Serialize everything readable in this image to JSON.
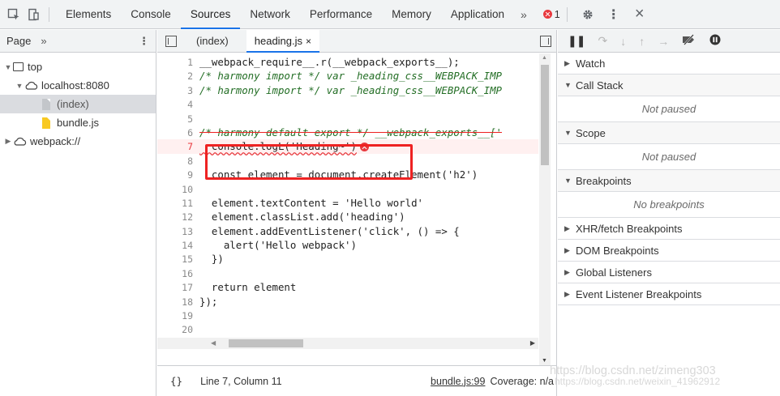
{
  "toolbar": {
    "tabs": [
      "Elements",
      "Console",
      "Sources",
      "Network",
      "Performance",
      "Memory",
      "Application"
    ],
    "active_tab": "Sources",
    "more": "»",
    "error_count": "1",
    "kebab": "⋮",
    "close": "×"
  },
  "navigator": {
    "tab": "Page",
    "chevron": "»",
    "kebab": "⋮",
    "tree": [
      {
        "label": "top"
      },
      {
        "label": "localhost:8080"
      },
      {
        "label": "(index)"
      },
      {
        "label": "bundle.js"
      },
      {
        "label": "webpack://"
      }
    ]
  },
  "editor": {
    "tabs": [
      {
        "label": "(index)"
      },
      {
        "label": "heading.js"
      }
    ],
    "close_glyph": "×",
    "lines": [
      {
        "n": "1",
        "t": "__webpack_require__.r(__webpack_exports__);"
      },
      {
        "n": "2",
        "t": "/* harmony import */ var _heading_css__WEBPACK_IMP"
      },
      {
        "n": "3",
        "t": "/* harmony import */ var _heading_css__WEBPACK_IMP"
      },
      {
        "n": "4",
        "t": ""
      },
      {
        "n": "5",
        "t": ""
      },
      {
        "n": "6",
        "t": "/* harmony default export */ __webpack_exports__['"
      },
      {
        "n": "7",
        "t": "  console.logL('Heading~')"
      },
      {
        "n": "8",
        "t": ""
      },
      {
        "n": "9",
        "t": "  const element = document.createElement('h2')"
      },
      {
        "n": "10",
        "t": ""
      },
      {
        "n": "11",
        "t": "  element.textContent = 'Hello world'"
      },
      {
        "n": "12",
        "t": "  element.classList.add('heading')"
      },
      {
        "n": "13",
        "t": "  element.addEventListener('click', () => {"
      },
      {
        "n": "14",
        "t": "    alert('Hello webpack')"
      },
      {
        "n": "15",
        "t": "  })"
      },
      {
        "n": "16",
        "t": ""
      },
      {
        "n": "17",
        "t": "  return element"
      },
      {
        "n": "18",
        "t": "});"
      },
      {
        "n": "19",
        "t": ""
      },
      {
        "n": "20",
        "t": ""
      }
    ],
    "status": {
      "braces": "{}",
      "position": "Line 7, Column 11",
      "source": "bundle.js:99",
      "coverage": "Coverage: n/a"
    }
  },
  "debugger": {
    "sections": [
      {
        "label": "Watch",
        "expanded": false
      },
      {
        "label": "Call Stack",
        "expanded": true,
        "body": "Not paused"
      },
      {
        "label": "Scope",
        "expanded": true,
        "body": "Not paused"
      },
      {
        "label": "Breakpoints",
        "expanded": true,
        "body": "No breakpoints"
      },
      {
        "label": "XHR/fetch Breakpoints",
        "expanded": false
      },
      {
        "label": "DOM Breakpoints",
        "expanded": false
      },
      {
        "label": "Global Listeners",
        "expanded": false
      },
      {
        "label": "Event Listener Breakpoints",
        "expanded": false
      }
    ]
  },
  "watermark": {
    "line1": "https://blog.csdn.net/zimeng303",
    "line2": "https://blog.csdn.net/weixin_41962912"
  }
}
